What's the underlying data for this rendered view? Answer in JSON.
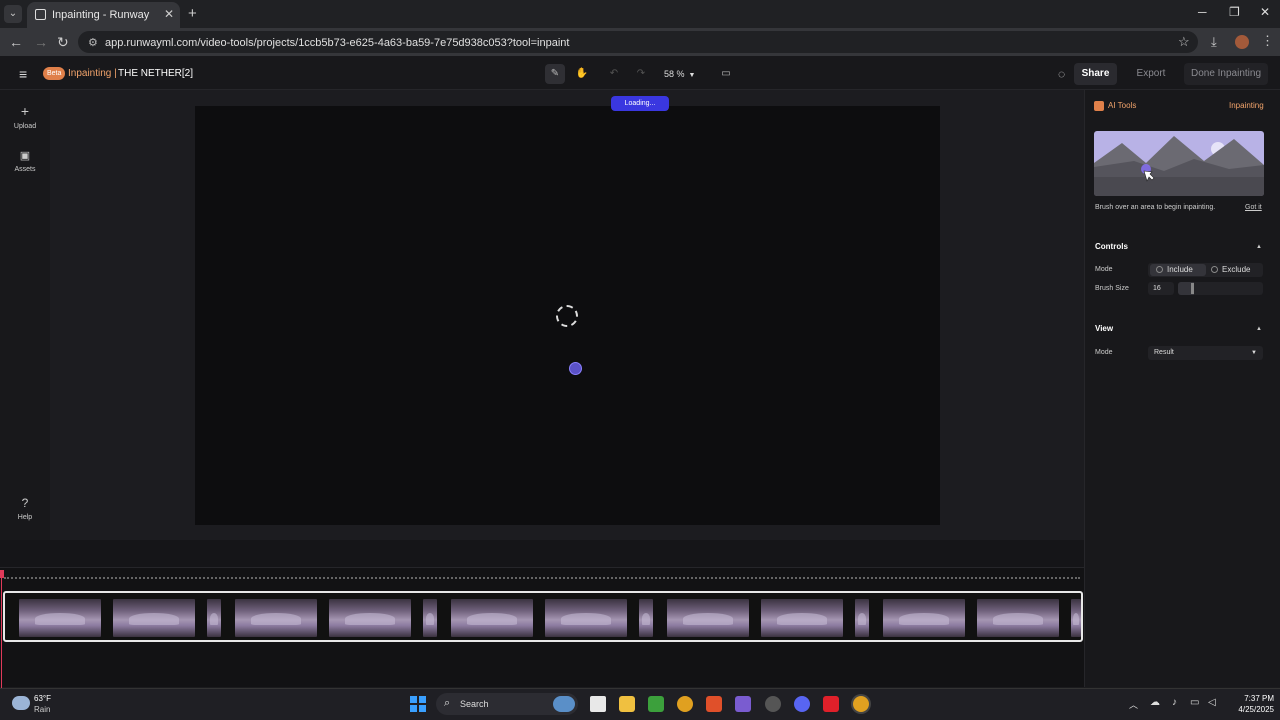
{
  "browser": {
    "tab_title": "Inpainting - Runway",
    "url": "app.runwayml.com/video-tools/projects/1ccb5b73-e625-4a63-ba59-7e75d938c053?tool=inpaint",
    "window_controls": {
      "minimize": "─",
      "maximize": "❐",
      "close": "✕"
    }
  },
  "header": {
    "beta_badge": "Beta",
    "tool_name": "Inpainting |",
    "project_name": "THE NETHER[2]",
    "zoom": "58 %",
    "share_label": "Share",
    "export_label": "Export",
    "done_label": "Done Inpainting"
  },
  "left_rail": {
    "items": [
      {
        "label": "Upload",
        "icon": "plus-icon"
      },
      {
        "label": "Assets",
        "icon": "folder-icon"
      }
    ],
    "help_label": "Help"
  },
  "canvas": {
    "loading_label": "Loading..."
  },
  "right_panel": {
    "section_label": "AI Tools",
    "tool_label": "Inpainting",
    "hint": "Brush over an area to begin inpainting.",
    "got_it": "Got it",
    "controls": {
      "title": "Controls",
      "mode_label": "Mode",
      "include_label": "Include",
      "exclude_label": "Exclude",
      "brush_size_label": "Brush Size",
      "brush_size_value": "16"
    },
    "view": {
      "title": "View",
      "mode_label": "Mode",
      "mode_value": "Result"
    }
  },
  "taskbar": {
    "weather_temp": "63°F",
    "weather_condition": "Rain",
    "search_label": "Search",
    "time": "7:37 PM",
    "date": "4/25/2025"
  },
  "colors": {
    "accent_orange": "#f1a36b",
    "loading_blue": "#3a37e0",
    "playhead_red": "#e03a5a"
  }
}
